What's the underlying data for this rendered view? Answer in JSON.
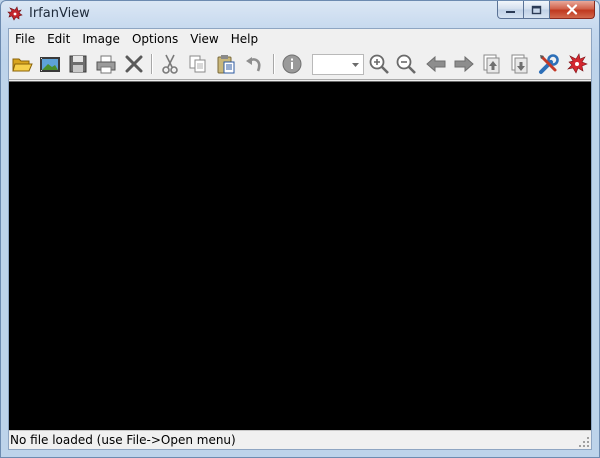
{
  "window": {
    "title": "IrfanView"
  },
  "menu": {
    "items": [
      "File",
      "Edit",
      "Image",
      "Options",
      "View",
      "Help"
    ]
  },
  "toolbar": {
    "zoom_value": ""
  },
  "status": {
    "text": "No file loaded (use File->Open menu)"
  },
  "colors": {
    "viewer_background": "#000000",
    "chrome_blue": "#bdd3ea",
    "close_button": "#c0391f"
  },
  "icons": {
    "app": "irfanview-cat-icon",
    "toolbar": [
      "open-folder-icon",
      "slideshow-icon",
      "save-icon",
      "print-icon",
      "delete-icon",
      "cut-icon",
      "copy-icon",
      "paste-icon",
      "undo-icon",
      "info-icon",
      "zoom-in-icon",
      "zoom-out-icon",
      "previous-arrow-icon",
      "next-arrow-icon",
      "first-page-icon",
      "last-page-icon",
      "settings-icon",
      "irfanview-logo-icon"
    ]
  }
}
